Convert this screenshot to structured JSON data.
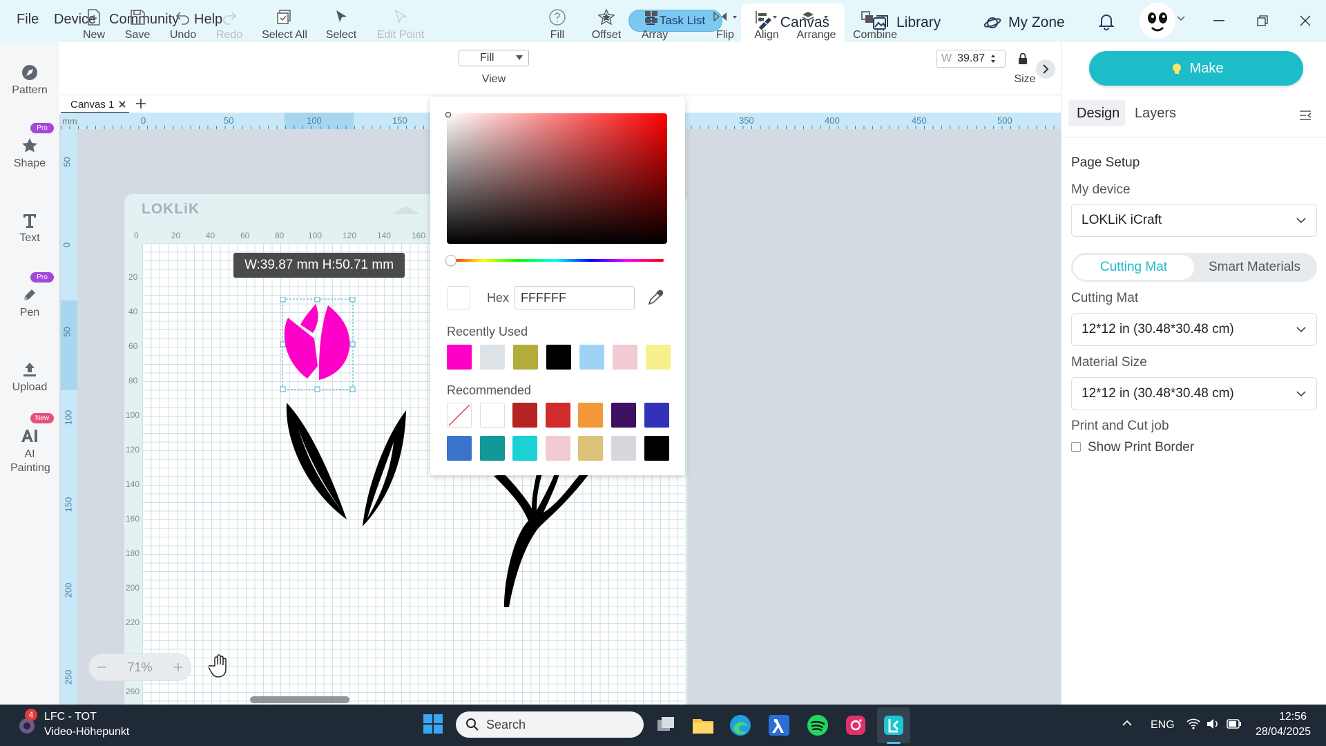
{
  "menubar": {
    "items": [
      "File",
      "Device",
      "Community",
      "Help"
    ]
  },
  "topbar": {
    "task_list": "Task List",
    "tabs": [
      "Canvas",
      "Library",
      "My Zone"
    ]
  },
  "sidebar": {
    "items": [
      {
        "label": "Pattern",
        "badge": ""
      },
      {
        "label": "Shape",
        "badge": "Pro"
      },
      {
        "label": "Text",
        "badge": ""
      },
      {
        "label": "Pen",
        "badge": "Pro"
      },
      {
        "label": "Upload",
        "badge": ""
      },
      {
        "label": "AI Painting",
        "badge": "New"
      }
    ]
  },
  "toolbar": {
    "new": "New",
    "save": "Save",
    "undo": "Undo",
    "redo": "Redo",
    "select_all": "Select All",
    "select": "Select",
    "edit_point": "Edit Point",
    "view_value": "Fill",
    "view": "View",
    "fill": "Fill",
    "offset": "Offset",
    "array": "Array",
    "flip": "Flip",
    "align": "Align",
    "arrange": "Arrange",
    "combine": "Combine",
    "w_label": "W",
    "w_value": "39.87",
    "size": "Size"
  },
  "canvas": {
    "tab_label": "Canvas 1",
    "ruler_unit": "mm",
    "top_ticks": [
      "0",
      "50",
      "100",
      "150",
      "350",
      "400",
      "450",
      "500"
    ],
    "left_ticks": [
      "50",
      "0",
      "50",
      "100",
      "150",
      "200",
      "250"
    ],
    "mat_logo": "LOKLiK",
    "mat_top_ticks": [
      "0",
      "20",
      "40",
      "60",
      "80",
      "100",
      "120",
      "140",
      "160"
    ],
    "mat_left_ticks": [
      "20",
      "40",
      "60",
      "80",
      "100",
      "120",
      "140",
      "160",
      "180",
      "200",
      "220",
      "260"
    ],
    "dimensions": "W:39.87 mm  H:50.71 mm",
    "zoom": "71%",
    "tulip_color": "#ff00c8"
  },
  "color_picker": {
    "hex_label": "Hex",
    "hex_value": "FFFFFF",
    "recently_used_label": "Recently Used",
    "recently_used": [
      "#ff00c8",
      "#dde3e6",
      "#b3ac3a",
      "#000000",
      "#9fd3f5",
      "#f2cbd2",
      "#f7f08c"
    ],
    "recommended_label": "Recommended",
    "recommended": [
      "none",
      "#ffffff",
      "#b52323",
      "#d22b2b",
      "#f2993a",
      "#3d1060",
      "#3232b8",
      "#3a72cc",
      "#13989a",
      "#1cd1d6",
      "#f2cad1",
      "#dcc17a",
      "#d8d8dc",
      "#000000"
    ]
  },
  "right_panel": {
    "make": "Make",
    "tabs": [
      "Design",
      "Layers"
    ],
    "page_setup": "Page Setup",
    "my_device_label": "My device",
    "device": "LOKLiK iCraft",
    "segment": [
      "Cutting Mat",
      "Smart Materials"
    ],
    "cutting_mat_label": "Cutting Mat",
    "cutting_mat": "12*12 in (30.48*30.48 cm)",
    "material_size_label": "Material Size",
    "material_size": "12*12 in (30.48*30.48 cm)",
    "print_cut_label": "Print and Cut job",
    "show_print_border": "Show Print Border"
  },
  "taskbar": {
    "notification_count": "4",
    "media_title": "LFC - TOT",
    "media_subtitle": "Video-Höhepunkt",
    "search": "Search",
    "lang": "ENG",
    "time": "12:56",
    "date": "28/04/2025"
  },
  "accent": "#1cbcc9"
}
